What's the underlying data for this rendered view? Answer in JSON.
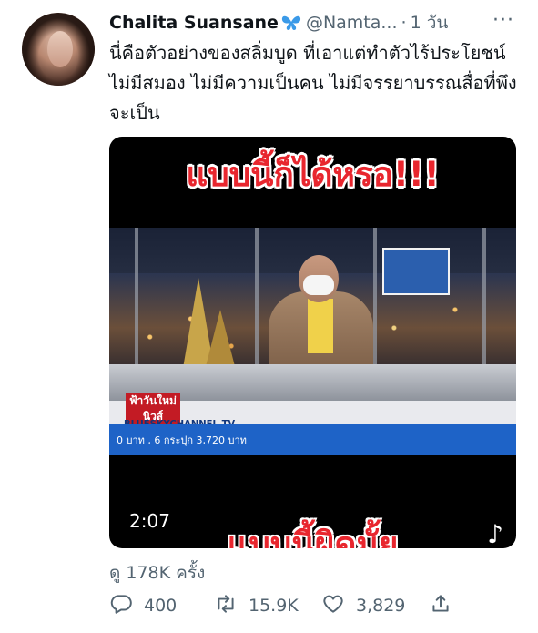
{
  "author": {
    "name": "Chalita Suansane",
    "handle": "@Namta...",
    "separator": "·",
    "time": "1 วัน"
  },
  "menu": {
    "more": "···"
  },
  "tweet": {
    "text": "นี่คือตัวอย่างของสลิ่มบูด ที่เอาแต่ทำตัวไร้ประโยชน์ ไม่มีสมอง ไม่มีความเป็นคน ไม่มีจรรยาบรรณสื่อที่พึงจะเป็น"
  },
  "media": {
    "caption_top": "แบบนี้ก็ได้หรอ!!!",
    "caption_bottom": "แบบนี้ผิดมั้ย",
    "duration": "2:07",
    "station_logo": "ฟ้าวันใหม่ นิวส์",
    "channel": "BLUESKYCHANNEL.TV",
    "ticker": "0 บาท , 6 กระปุก 3,720 บาท"
  },
  "views": "ดู 178K ครั้ง",
  "actions": {
    "replies": "400",
    "retweets": "15.9K",
    "likes": "3,829"
  },
  "colors": {
    "text": "#0f1419",
    "secondary": "#536471",
    "caption": "#e8262e"
  }
}
